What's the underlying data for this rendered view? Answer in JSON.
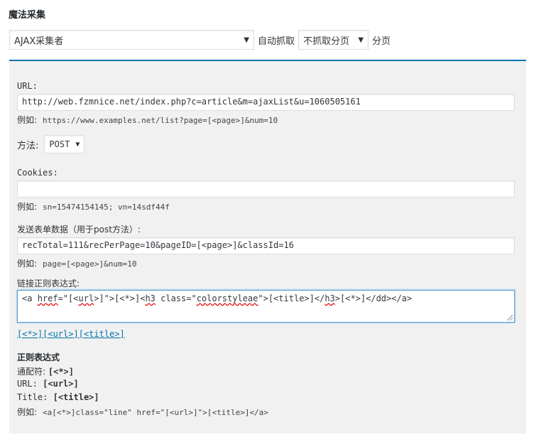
{
  "page": {
    "title": "魔法采集"
  },
  "top": {
    "collector_select": {
      "value": "AJAX采集者"
    },
    "auto_label": "自动抓取",
    "paging_select": {
      "value": "不抓取分页"
    },
    "paging_label": "分页"
  },
  "form": {
    "url": {
      "label": "URL:",
      "value": "http://web.fzmnice.net/index.php?c=article&m=ajaxList&u=1060505161",
      "example_label": "例如:",
      "example": "https://www.examples.net/list?page=[<page>]&num=10"
    },
    "method": {
      "label": "方法:",
      "value": "POST"
    },
    "cookies": {
      "label": "Cookies:",
      "value": "",
      "example_label": "例如:",
      "example": "sn=15474154145; vn=14sdf44f"
    },
    "post_data": {
      "label": "发送表单数据（用于post方法）:",
      "value": "recTotal=111&recPerPage=10&pageID=[<page>]&classId=16",
      "example_label": "例如:",
      "example": "page=[<page>]&num=10"
    },
    "link_regex": {
      "label": "链接正则表达式:",
      "parts": [
        "<a ",
        "href",
        "=\"[<",
        "url",
        ">]\">[<*>]<",
        "h3",
        " class=\"",
        "colorstyleae",
        "\">[<title>]</",
        "h3",
        ">[<*>]</dd></a>"
      ]
    },
    "tokens": [
      "[<*>]",
      "[<url>]",
      "[<title>]"
    ]
  },
  "help": {
    "title": "正则表达式",
    "wildcard_label": "通配符:",
    "wildcard": "[<*>]",
    "url_label": "URL:",
    "url": "[<url>]",
    "title_label": "Title:",
    "title_token": "[<title>]",
    "example_label": "例如:",
    "example": "<a[<*>]class=\"line\" href=\"[<url>]\">[<title>]</a>"
  }
}
